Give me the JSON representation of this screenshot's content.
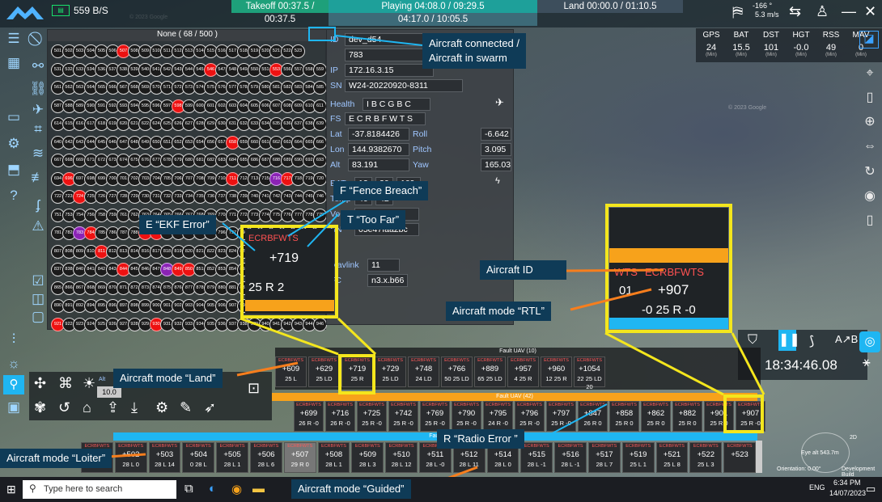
{
  "topbar": {
    "speed": "559 B/S",
    "takeoff": "Takeoff 00:37.5 / 00:37.5",
    "playing": "Playing 04:08.0 / 09:29.5",
    "playing_sub": "04:17.0 / 10:05.5",
    "land": "Land 00:00.0 / 01:10.5",
    "wind": "-166 °",
    "wind_speed": "5.3 m/s"
  },
  "grid": {
    "header": "None ( 68 / 500 )",
    "rows": [
      [
        "501",
        "502",
        "503",
        "504",
        "505",
        "506",
        "507",
        "508",
        "509",
        "510",
        "511",
        "512",
        "513",
        "514",
        "515",
        "516",
        "517",
        "518",
        "519",
        "520",
        "521",
        "522",
        "523"
      ],
      [
        "531",
        "532",
        "533",
        "534",
        "536",
        "537",
        "538",
        "539",
        "540",
        "541",
        "542",
        "543",
        "544",
        "545",
        "546",
        "547",
        "548",
        "549",
        "550",
        "551",
        "553",
        "556",
        "557",
        "558",
        "559"
      ],
      [
        "561",
        "562",
        "563",
        "564",
        "565",
        "566",
        "567",
        "568",
        "569",
        "570",
        "571",
        "572",
        "573",
        "574",
        "575",
        "576",
        "577",
        "578",
        "579",
        "580",
        "581",
        "582",
        "583",
        "584",
        "585",
        "586"
      ],
      [
        "587",
        "588",
        "589",
        "590",
        "591",
        "592",
        "593",
        "594",
        "595",
        "596",
        "597",
        "598",
        "599",
        "600",
        "601",
        "602",
        "603",
        "604",
        "605",
        "606",
        "607",
        "608",
        "609",
        "610",
        "611",
        "613"
      ],
      [
        "614",
        "615",
        "616",
        "617",
        "618",
        "619",
        "620",
        "621",
        "622",
        "624",
        "625",
        "626",
        "627",
        "628",
        "629",
        "630",
        "631",
        "632",
        "633",
        "634",
        "635",
        "636",
        "637",
        "638",
        "639"
      ],
      [
        "640",
        "642",
        "643",
        "644",
        "645",
        "646",
        "647",
        "648",
        "649",
        "650",
        "651",
        "652",
        "653",
        "654",
        "656",
        "657",
        "658",
        "659",
        "660",
        "661",
        "662",
        "663",
        "664",
        "665",
        "666"
      ],
      [
        "667",
        "668",
        "669",
        "671",
        "672",
        "673",
        "674",
        "675",
        "676",
        "677",
        "678",
        "679",
        "680",
        "681",
        "682",
        "683",
        "684",
        "685",
        "686",
        "687",
        "688",
        "689",
        "690",
        "692",
        "693"
      ],
      [
        "694",
        "696",
        "697",
        "698",
        "699",
        "700",
        "701",
        "702",
        "703",
        "704",
        "705",
        "706",
        "707",
        "708",
        "709",
        "710",
        "711",
        "712",
        "713",
        "715",
        "716",
        "717",
        "718",
        "719",
        "720",
        "721"
      ],
      [
        "722",
        "723",
        "724",
        "725",
        "726",
        "727",
        "728",
        "729",
        "730",
        "731",
        "732",
        "733",
        "734",
        "735",
        "736",
        "737",
        "738",
        "739",
        "740",
        "741",
        "742",
        "743",
        "744",
        "745",
        "746",
        "748",
        "749"
      ],
      [
        "751",
        "753",
        "754",
        "756",
        "758",
        "759",
        "761",
        "762",
        "763",
        "764",
        "765",
        "766",
        "767",
        "768",
        "769",
        "770",
        "771",
        "772",
        "773",
        "774",
        "775",
        "776",
        "777",
        "778",
        "779"
      ],
      [
        "781",
        "782",
        "783",
        "784",
        "785",
        "786",
        "787",
        "788",
        "789",
        "790",
        "791",
        "792",
        "793",
        "794",
        "795",
        "796",
        "797",
        "798",
        "800",
        "801",
        "802",
        "803",
        "804",
        "805",
        "806"
      ],
      [
        "807",
        "808",
        "809",
        "810",
        "811",
        "812",
        "813",
        "814",
        "816",
        "817",
        "818",
        "819",
        "820",
        "821",
        "822",
        "823",
        "824",
        "825",
        "826",
        "829",
        "831",
        "832",
        "833",
        "834",
        "835",
        "836"
      ],
      [
        "837",
        "838",
        "840",
        "841",
        "842",
        "843",
        "844",
        "845",
        "846",
        "847",
        "848",
        "849",
        "850",
        "851",
        "852",
        "853",
        "854",
        "855",
        "856",
        "857",
        "858",
        "859",
        "860",
        "861",
        "862",
        "863"
      ],
      [
        "865",
        "866",
        "867",
        "868",
        "869",
        "870",
        "871",
        "872",
        "873",
        "874",
        "875",
        "876",
        "877",
        "878",
        "879",
        "880",
        "881",
        "882",
        "883",
        "884",
        "885",
        "886",
        "887",
        "888",
        "889"
      ],
      [
        "890",
        "891",
        "892",
        "894",
        "895",
        "896",
        "897",
        "898",
        "899",
        "900",
        "901",
        "902",
        "903",
        "904",
        "905",
        "906",
        "907",
        "908",
        "909",
        "911",
        "912",
        "913",
        "914",
        "915",
        "916"
      ],
      [
        "921",
        "922",
        "923",
        "924",
        "925",
        "926",
        "927",
        "928",
        "929",
        "930",
        "931",
        "932",
        "933",
        "934",
        "935",
        "936",
        "937",
        "938",
        "939",
        "940",
        "941",
        "942",
        "943",
        "944",
        "946",
        "947",
        "948"
      ]
    ]
  },
  "info": {
    "id_label": "ID",
    "id": "dev_d54",
    "num": "783",
    "ip_label": "IP",
    "ip": "172.16.3.15",
    "sn_label": "SN",
    "sn": "W24-20220920-8311",
    "health_label": "Health",
    "health": "I B C G B C",
    "fs_label": "FS",
    "fs": "E C R B F W T S",
    "lat_label": "Lat",
    "lat": "-37.8184426",
    "roll_label": "Roll",
    "roll": "-6.642",
    "lon_label": "Lon",
    "lon": "144.9382670",
    "pitch_label": "Pitch",
    "pitch": "3.095",
    "alt_label": "Alt",
    "alt": "83.191",
    "yaw_label": "Yaw",
    "yaw": "165.03",
    "bat_label": "BAT",
    "bat": [
      "12",
      "30",
      "109"
    ],
    "temp_label": "Temp",
    "temp": [
      "40",
      "42"
    ],
    "voc_label": "VoC",
    "voc": "3.90 3.89 3.",
    "sn2_label": "SN",
    "sn2": "05e47faa2bc",
    "mavlink_label": "Mavlink",
    "mavlink": "11",
    "fc_label": "FC",
    "fc": "n3.x.b66"
  },
  "stats": {
    "headers": [
      "GPS",
      "BAT",
      "DST",
      "HGT",
      "RSS",
      "MAV"
    ],
    "values": [
      "24",
      "15.5",
      "101",
      "-0.0",
      "49",
      "0"
    ],
    "mins": [
      "(Min)",
      "(Min)",
      "(Min)",
      "(Min)",
      "(Min)",
      "(Min)"
    ]
  },
  "clock": "18:34:46.08",
  "faults": {
    "fault1_title": "Fault UAV (10)",
    "fault1": [
      {
        "id": "+609",
        "sub": "25 L"
      },
      {
        "id": "+629",
        "sub": "25 LD"
      },
      {
        "id": "+719",
        "sub": "25 R"
      },
      {
        "id": "+729",
        "sub": "25 LD"
      },
      {
        "id": "+748",
        "sub": "24 LD"
      },
      {
        "id": "+766",
        "sub": "50 25 LD"
      },
      {
        "id": "+889",
        "sub": "65 25 LD"
      },
      {
        "id": "+957",
        "sub": "4 25 R"
      },
      {
        "id": "+960",
        "sub": "12 25 R"
      },
      {
        "id": "+1054",
        "sub": "22 25 LD 20"
      }
    ],
    "fault2_title": "Fault UAV (42)",
    "fault2": [
      {
        "id": "+699",
        "sub": "26 R -0"
      },
      {
        "id": "+716",
        "sub": "26 R -0"
      },
      {
        "id": "+725",
        "sub": "25 R -0"
      },
      {
        "id": "+742",
        "sub": "25 R -0"
      },
      {
        "id": "+769",
        "sub": "25 R -0"
      },
      {
        "id": "+790",
        "sub": "25 R -0"
      },
      {
        "id": "+795",
        "sub": "24 R -0"
      },
      {
        "id": "+796",
        "sub": "25 R -0"
      },
      {
        "id": "+797",
        "sub": "25 R -0"
      },
      {
        "id": "+847",
        "sub": "26 R 0"
      },
      {
        "id": "+858",
        "sub": "25 R 0"
      },
      {
        "id": "+862",
        "sub": "25 R 0"
      },
      {
        "id": "+882",
        "sub": "25 R 0"
      },
      {
        "id": "+901",
        "sub": "25 R 0"
      },
      {
        "id": "+907",
        "sub": "25 R -0"
      }
    ],
    "fault3_title": "Fault",
    "fault3": [
      {
        "id": "+501",
        "sub": "28 L -1"
      },
      {
        "id": "+502",
        "sub": "28 L 0"
      },
      {
        "id": "+503",
        "sub": "28 L 14"
      },
      {
        "id": "+504",
        "sub": "0 28 L"
      },
      {
        "id": "+505",
        "sub": "28 L 1"
      },
      {
        "id": "+506",
        "sub": "28 L 6"
      },
      {
        "id": "+507",
        "sub": "29 R 0"
      },
      {
        "id": "+508",
        "sub": "28 L 1"
      },
      {
        "id": "+509",
        "sub": "28 L 3"
      },
      {
        "id": "+510",
        "sub": "28 L 12"
      },
      {
        "id": "+511",
        "sub": "28 L -0"
      },
      {
        "id": "+512",
        "sub": "28 L 11"
      },
      {
        "id": "+514",
        "sub": "28 L 0"
      },
      {
        "id": "+515",
        "sub": "28 L -1"
      },
      {
        "id": "+516",
        "sub": "28 L -1"
      },
      {
        "id": "+517",
        "sub": "28 L 7"
      },
      {
        "id": "+519",
        "sub": "25 L 1"
      },
      {
        "id": "+521",
        "sub": "25 L 8"
      },
      {
        "id": "+522",
        "sub": "25 L 3"
      },
      {
        "id": "+523",
        "sub": ""
      }
    ],
    "flags": "ECRBFWTS"
  },
  "annotations": {
    "connected": "Aircraft connected /\nAircraft in swarm",
    "fence": "F “Fence Breach”",
    "toofar": "T “Too Far”",
    "ekf": "E “EKF Error”",
    "aircraft_id": "Aircraft ID",
    "rtl": "Aircraft mode “RTL”",
    "land": "Aircraft mode “Land”",
    "radio": "R “Radio Error ”",
    "loiter": "Aircraft mode “Loiter”",
    "guided": "Aircraft mode “Guided”"
  },
  "zoom1": {
    "flags": "ECRBFWTS",
    "id": "+719",
    "bottom": "25 R 2",
    "left_num": "1",
    "right_num": "25"
  },
  "zoom2": {
    "flags": "ECRBFWTS",
    "left_flags": "WTS",
    "id": "+907",
    "bottom": "-0 25 R -0",
    "left_num": "01"
  },
  "map": {
    "eye": "Eye alt 543.7m",
    "orientation": "Orientation: 0.00°",
    "dev": "Development Build",
    "watermark": "© 2023 Google"
  },
  "alt_panel": {
    "label": "Alt",
    "value": "10.0"
  },
  "taskbar": {
    "search_placeholder": "Type here to search",
    "time": "6:34 PM",
    "date": "14/07/2023",
    "lang": "ENG"
  },
  "colors": {
    "accent": "#1fb6f2",
    "fault_orange": "#f7a21b",
    "callout_yellow": "#f4e61d",
    "callout_bg": "#0f3b57",
    "red": "#ee1111"
  }
}
